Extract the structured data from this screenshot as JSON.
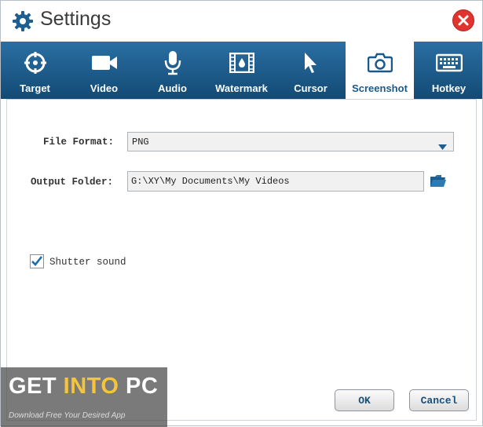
{
  "window": {
    "title": "Settings"
  },
  "tabs": [
    {
      "label": "Target",
      "icon": "crosshair-icon"
    },
    {
      "label": "Video",
      "icon": "video-camera-icon"
    },
    {
      "label": "Audio",
      "icon": "microphone-icon"
    },
    {
      "label": "Watermark",
      "icon": "film-watermark-icon"
    },
    {
      "label": "Cursor",
      "icon": "cursor-arrow-icon"
    },
    {
      "label": "Screenshot",
      "icon": "camera-icon",
      "active": true
    },
    {
      "label": "Hotkey",
      "icon": "keyboard-icon"
    }
  ],
  "form": {
    "file_format_label": "File Format:",
    "file_format_value": "PNG",
    "output_folder_label": "Output Folder:",
    "output_folder_value": "G:\\XY\\My Documents\\My Videos",
    "shutter_sound_label": "Shutter sound",
    "shutter_sound_checked": true
  },
  "buttons": {
    "ok": "OK",
    "cancel": "Cancel"
  },
  "watermark": {
    "title_part1": "GET ",
    "title_part2": "INTO",
    "title_part3": " PC",
    "subtitle": "Download Free Your Desired App"
  },
  "colors": {
    "tab_bar": "#1b5b8c",
    "active_tab_text": "#1a5a8b",
    "close_button": "#e0342e",
    "button_text": "#1a4f78"
  }
}
